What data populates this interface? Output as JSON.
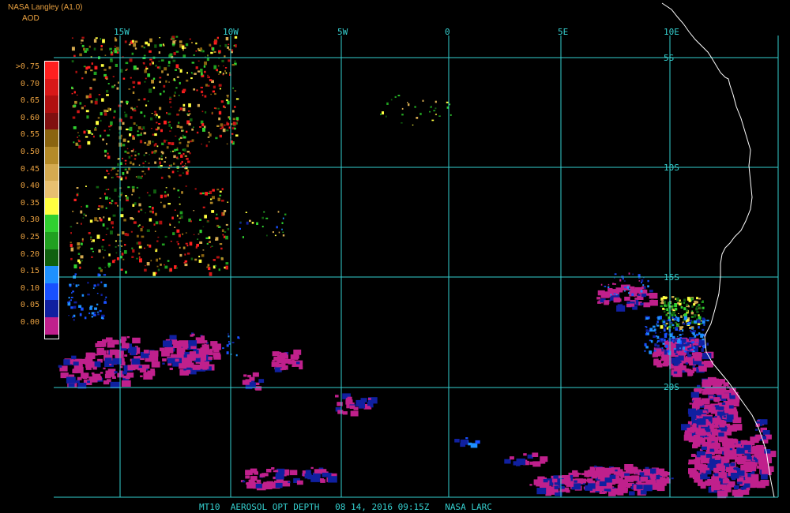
{
  "header": {
    "title": "NASA Langley (A1.0)",
    "subtitle": "AOD"
  },
  "legend": {
    "labels": [
      ">0.75",
      "0.70",
      "0.65",
      "0.60",
      "0.55",
      "0.50",
      "0.45",
      "0.40",
      "0.35",
      "0.30",
      "0.25",
      "0.20",
      "0.15",
      "0.10",
      "0.05",
      "0.00"
    ],
    "colors": [
      "#ff2020",
      "#d81818",
      "#b01010",
      "#801010",
      "#8a6410",
      "#b48a28",
      "#d4aa50",
      "#e8c070",
      "#ffff40",
      "#30d030",
      "#20a020",
      "#106010",
      "#1e90ff",
      "#1850ff",
      "#1020a0",
      "#c0208c"
    ]
  },
  "grid": {
    "lon_labels": [
      "15W",
      "10W",
      "5W",
      "0",
      "5E",
      "10E"
    ],
    "lat_labels": [
      "5S",
      "10S",
      "15S",
      "20S"
    ],
    "line_color": "#35d0d0"
  },
  "footer": {
    "text": "MT10  AEROSOL OPT DEPTH   08 14, 2016 09:15Z   NASA LARC"
  },
  "colors": {
    "coast": "#ffffff",
    "text": "#e8a040"
  }
}
